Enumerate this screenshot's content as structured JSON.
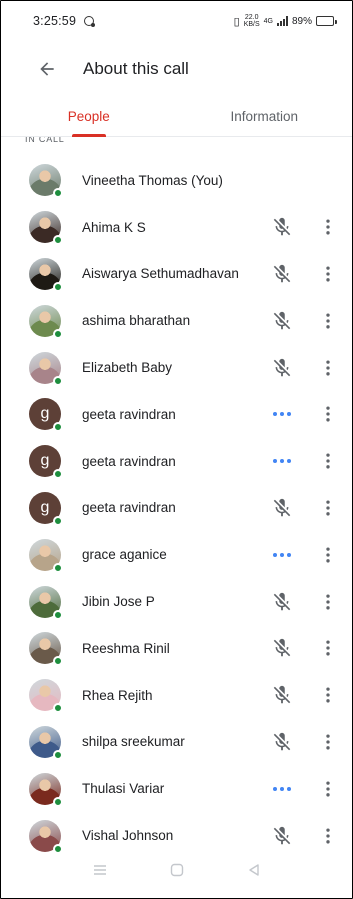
{
  "status_bar": {
    "time": "3:25:59",
    "net_speed": "22.0",
    "net_unit": "KB/S",
    "net_type": "4G",
    "battery_pct": "89%"
  },
  "header": {
    "title": "About this call"
  },
  "tabs": [
    {
      "label": "People",
      "active": true
    },
    {
      "label": "Information",
      "active": false
    }
  ],
  "section_label": "IN CALL",
  "colors": {
    "accent": "#d93025",
    "online": "#1e8e3e",
    "speaking": "#4285f4"
  },
  "participants": [
    {
      "name": "Vineetha Thomas (You)",
      "status": "none",
      "avatar": "photo",
      "avatar_color": "#6b7b6a"
    },
    {
      "name": "Ahima K S",
      "status": "mic-off-icon",
      "avatar": "photo",
      "avatar_color": "#3b2a25"
    },
    {
      "name": "Aiswarya Sethumadhavan",
      "status": "mic-off-icon",
      "avatar": "photo",
      "avatar_color": "#1e1a14"
    },
    {
      "name": "ashima bharathan",
      "status": "mic-off-icon",
      "avatar": "photo",
      "avatar_color": "#6d8a4e"
    },
    {
      "name": "Elizabeth Baby",
      "status": "mic-off-icon",
      "avatar": "photo",
      "avatar_color": "#a8848a"
    },
    {
      "name": "geeta ravindran",
      "status": "speaking-icon",
      "avatar": "letter",
      "letter": "g",
      "avatar_color": "#5d4037"
    },
    {
      "name": "geeta ravindran",
      "status": "speaking-icon",
      "avatar": "letter",
      "letter": "g",
      "avatar_color": "#5d4037"
    },
    {
      "name": "geeta ravindran",
      "status": "mic-off-icon",
      "avatar": "letter",
      "letter": "g",
      "avatar_color": "#5d4037"
    },
    {
      "name": "grace aganice",
      "status": "speaking-icon",
      "avatar": "photo",
      "avatar_color": "#b7a48a"
    },
    {
      "name": "Jibin Jose P",
      "status": "mic-off-icon",
      "avatar": "photo",
      "avatar_color": "#4d6b3a"
    },
    {
      "name": "Reeshma Rinil",
      "status": "mic-off-icon",
      "avatar": "photo",
      "avatar_color": "#6a5a4a"
    },
    {
      "name": "Rhea Rejith",
      "status": "mic-off-icon",
      "avatar": "photo",
      "avatar_color": "#e6b8c0"
    },
    {
      "name": "shilpa sreekumar",
      "status": "mic-off-icon",
      "avatar": "photo",
      "avatar_color": "#3e5a8a"
    },
    {
      "name": "Thulasi Variar",
      "status": "speaking-icon",
      "avatar": "photo",
      "avatar_color": "#7a2a1e"
    },
    {
      "name": "Vishal Johnson",
      "status": "mic-off-icon",
      "avatar": "photo",
      "avatar_color": "#8a4a4a"
    }
  ],
  "nav": [
    "menu-icon",
    "home-icon",
    "back-icon"
  ]
}
